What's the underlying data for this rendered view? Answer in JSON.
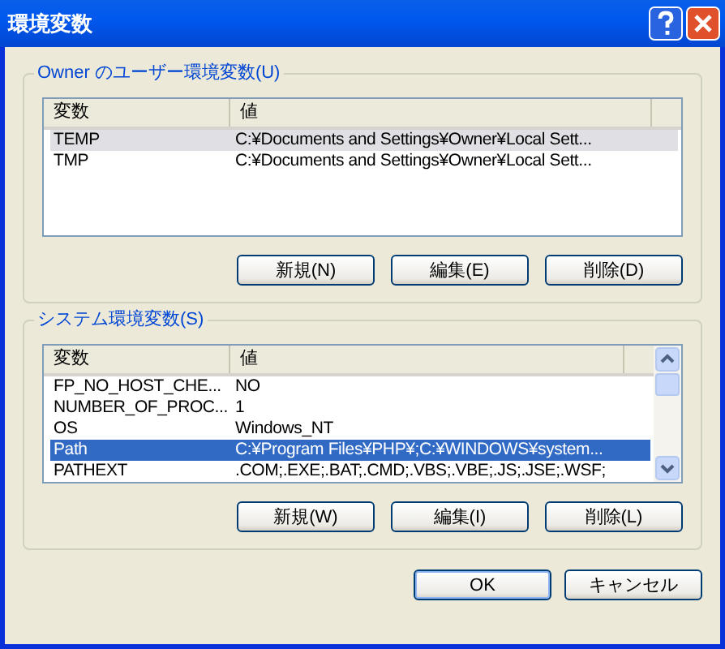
{
  "window": {
    "title": "環境変数"
  },
  "groups": [
    {
      "label": "Owner のユーザー環境変数(U)",
      "scrollbar": false,
      "columns": [
        "変数",
        "値"
      ],
      "rows": [
        {
          "name": "TEMP",
          "value": "C:¥Documents and Settings¥Owner¥Local Sett...",
          "selected": true
        },
        {
          "name": "TMP",
          "value": "C:¥Documents and Settings¥Owner¥Local Sett...",
          "selected": false
        }
      ],
      "focused": false,
      "buttons": [
        "新規(N)",
        "編集(E)",
        "削除(D)"
      ]
    },
    {
      "label": "システム環境変数(S)",
      "scrollbar": true,
      "columns": [
        "変数",
        "値"
      ],
      "rows": [
        {
          "name": "FP_NO_HOST_CHE...",
          "value": "NO",
          "selected": false
        },
        {
          "name": "NUMBER_OF_PROC...",
          "value": "1",
          "selected": false
        },
        {
          "name": "OS",
          "value": "Windows_NT",
          "selected": false
        },
        {
          "name": "Path",
          "value": "C:¥Program Files¥PHP¥;C:¥WINDOWS¥system...",
          "selected": true
        },
        {
          "name": "PATHEXT",
          "value": ".COM;.EXE;.BAT;.CMD;.VBS;.VBE;.JS;.JSE;.WSF;",
          "selected": false
        }
      ],
      "focused": true,
      "buttons": [
        "新規(W)",
        "編集(I)",
        "削除(L)"
      ]
    }
  ],
  "buttons": [
    "OK",
    "キャンセル"
  ]
}
